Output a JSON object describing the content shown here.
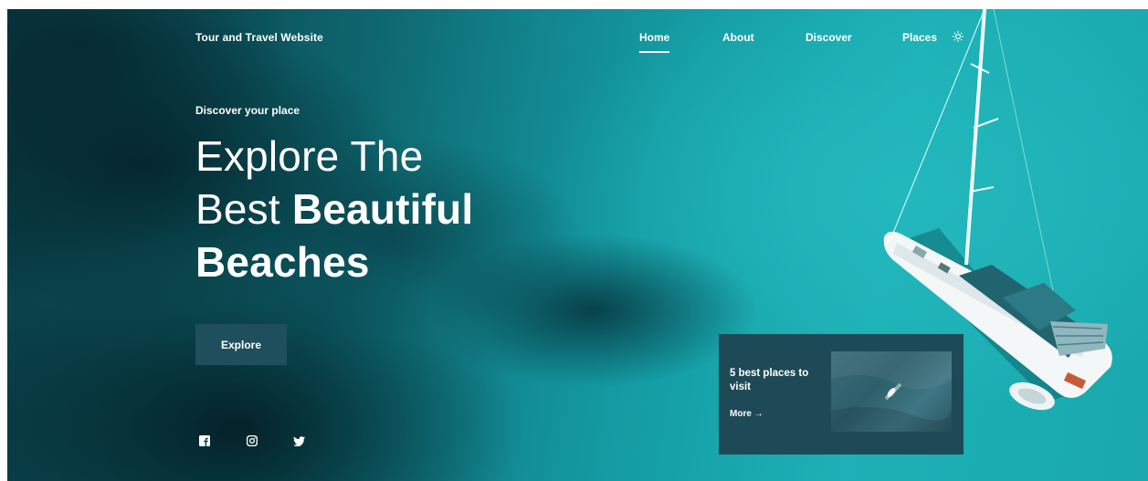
{
  "header": {
    "brand": "Tour and Travel Website",
    "nav": [
      {
        "label": "Home",
        "active": true
      },
      {
        "label": "About",
        "active": false
      },
      {
        "label": "Discover",
        "active": false
      },
      {
        "label": "Places",
        "active": false
      }
    ],
    "theme_icon": "sun-icon"
  },
  "hero": {
    "subtitle": "Discover your place",
    "title_line1": "Explore The",
    "title_line2_regular": "Best ",
    "title_line2_bold": "Beautiful",
    "title_line3_bold": "Beaches",
    "button_label": "Explore"
  },
  "social": {
    "icons": [
      "facebook-icon",
      "instagram-icon",
      "twitter-icon"
    ]
  },
  "card": {
    "title": "5 best places to visit",
    "more_label": "More",
    "more_icon": "arrow-right-icon"
  },
  "colors": {
    "card_bg": "#1e4a57",
    "button_bg": "#1f4f5c",
    "sea": "#1aa8ae"
  }
}
